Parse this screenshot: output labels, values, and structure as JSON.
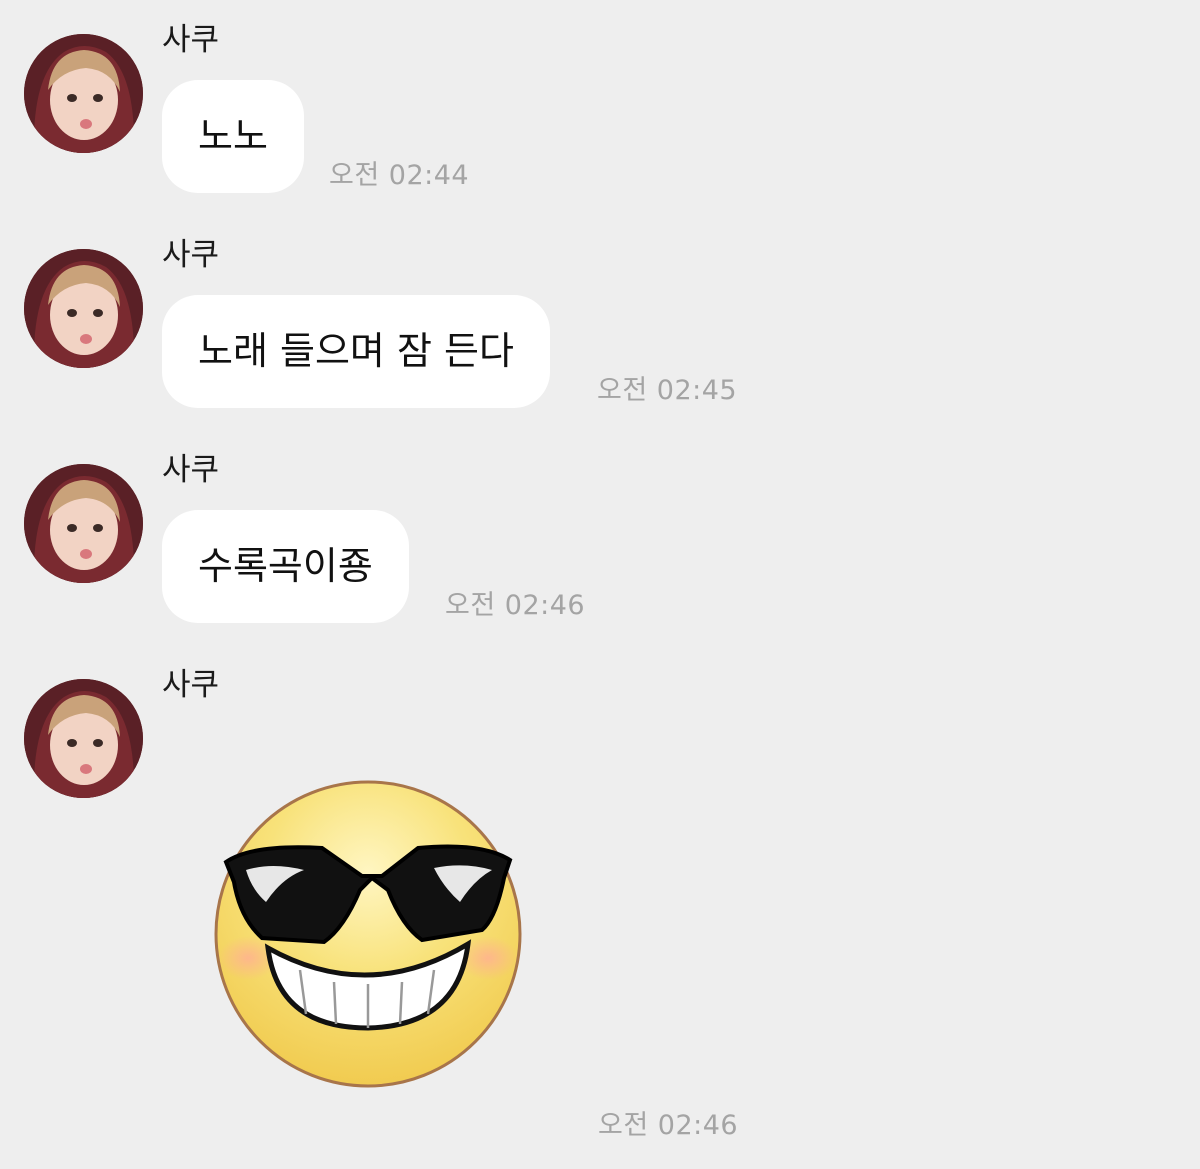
{
  "messages": [
    {
      "sender": "사쿠",
      "text": "노노",
      "time": "오전 02:44"
    },
    {
      "sender": "사쿠",
      "text": "노래 들으며 잠 든다",
      "time": "오전 02:45"
    },
    {
      "sender": "사쿠",
      "text": "수록곡이죵",
      "time": "오전 02:46"
    },
    {
      "sender": "사쿠",
      "sticker": "sunglasses-grin-emoji",
      "time": "오전 02:46"
    }
  ],
  "colors": {
    "background": "#eeeeee",
    "bubble": "#ffffff",
    "time": "#a4a4a4",
    "sticker_face": "#f7d94c"
  }
}
